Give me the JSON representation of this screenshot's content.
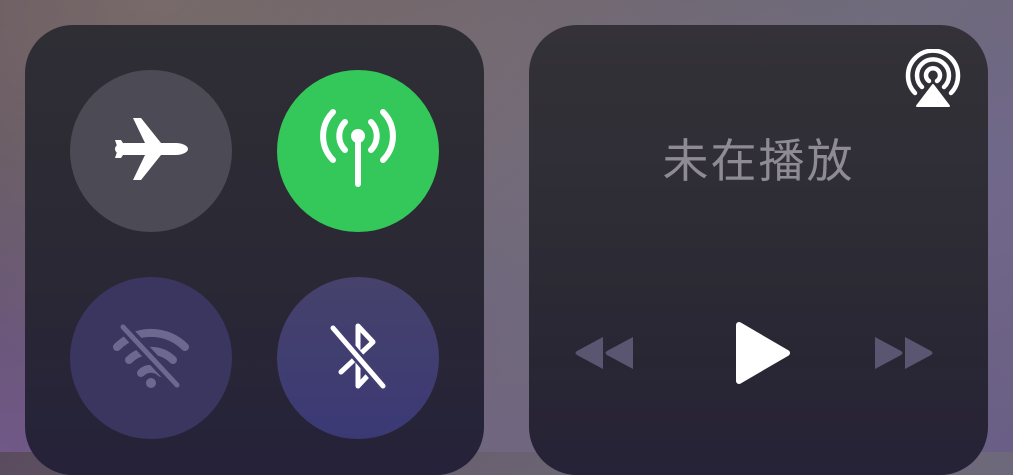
{
  "connectivity": {
    "airplane": {
      "icon": "airplane-icon",
      "state": "off"
    },
    "cellular": {
      "icon": "antenna-icon",
      "state": "on",
      "color": "#34c759"
    },
    "wifi": {
      "icon": "wifi-off-icon",
      "state": "off"
    },
    "bluetooth": {
      "icon": "bluetooth-off-icon",
      "state": "off"
    }
  },
  "media": {
    "status": "未在播放",
    "airplay_icon": "airplay-icon",
    "controls": {
      "previous_icon": "rewind-icon",
      "play_icon": "play-icon",
      "next_icon": "fast-forward-icon"
    }
  }
}
